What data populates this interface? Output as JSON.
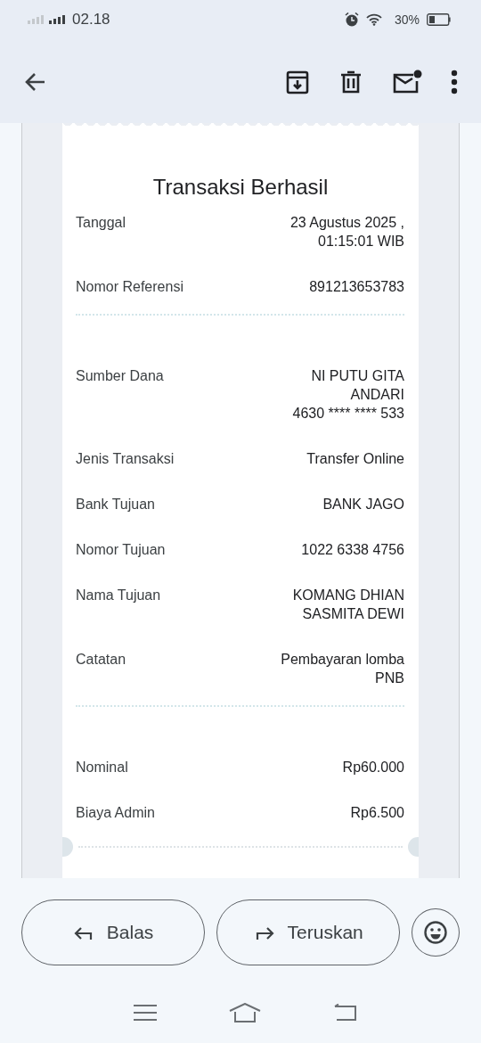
{
  "status_bar": {
    "time": "02.18",
    "battery": "30%"
  },
  "app_bar": {
    "actions": [
      {
        "kind": "back"
      },
      {
        "kind": "archive"
      },
      {
        "kind": "delete"
      },
      {
        "kind": "mark_unread"
      },
      {
        "kind": "more"
      }
    ]
  },
  "receipt": {
    "title": "Transaksi Berhasil",
    "sections": [
      {
        "rows": [
          {
            "label": "Tanggal",
            "value_lines": [
              "23 Agustus 2025 ,",
              "01:15:01 WIB"
            ]
          },
          {
            "label": "Nomor Referensi",
            "value_lines": [
              "891213653783"
            ]
          }
        ]
      },
      {
        "rows": [
          {
            "label": "Sumber Dana",
            "value_lines": [
              "NI PUTU GITA",
              "ANDARI",
              "4630 **** **** 533"
            ]
          },
          {
            "label": "Jenis Transaksi",
            "value_lines": [
              "Transfer Online"
            ]
          },
          {
            "label": "Bank Tujuan",
            "value_lines": [
              "BANK JAGO"
            ]
          },
          {
            "label": "Nomor Tujuan",
            "value_lines": [
              "1022 6338 4756"
            ]
          },
          {
            "label": "Nama Tujuan",
            "value_lines": [
              "KOMANG DHIAN",
              "SASMITA DEWI"
            ]
          },
          {
            "label": "Catatan",
            "value_lines": [
              "Pembayaran lomba",
              "PNB"
            ]
          }
        ]
      },
      {
        "rows": [
          {
            "label": "Nominal",
            "value_lines": [
              "Rp60.000"
            ]
          },
          {
            "label": "Biaya Admin",
            "value_lines": [
              "Rp6.500"
            ]
          }
        ]
      }
    ]
  },
  "bottom_actions": [
    {
      "kind": "reply",
      "label": "Balas"
    },
    {
      "kind": "forward",
      "label": "Teruskan"
    },
    {
      "kind": "emoji"
    }
  ]
}
